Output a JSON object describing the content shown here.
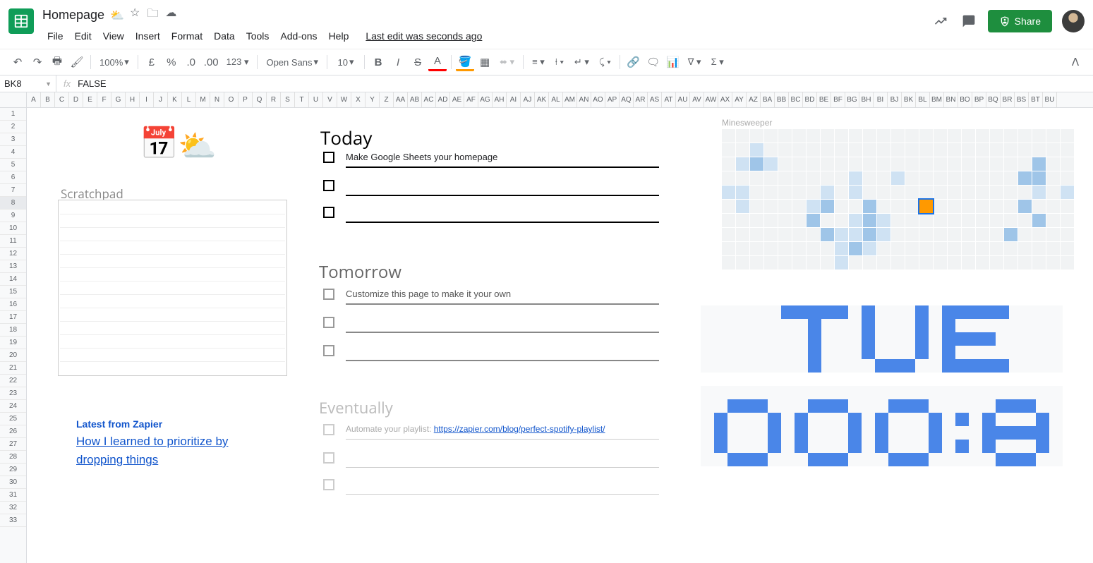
{
  "doc": {
    "title": "Homepage",
    "emoji": "⛅",
    "last_edit": "Last edit was seconds ago"
  },
  "menus": [
    "File",
    "Edit",
    "View",
    "Insert",
    "Format",
    "Data",
    "Tools",
    "Add-ons",
    "Help"
  ],
  "toolbar": {
    "zoom": "100%",
    "font": "Open Sans",
    "size": "10"
  },
  "share_label": "Share",
  "namebox": "BK8",
  "formula": "FALSE",
  "columns": [
    "A",
    "B",
    "C",
    "D",
    "E",
    "F",
    "G",
    "H",
    "I",
    "J",
    "K",
    "L",
    "M",
    "N",
    "O",
    "P",
    "Q",
    "R",
    "S",
    "T",
    "U",
    "V",
    "W",
    "X",
    "Y",
    "Z",
    "AA",
    "AB",
    "AC",
    "AD",
    "AE",
    "AF",
    "AG",
    "AH",
    "AI",
    "AJ",
    "AK",
    "AL",
    "AM",
    "AN",
    "AO",
    "AP",
    "AQ",
    "AR",
    "AS",
    "AT",
    "AU",
    "AV",
    "AW",
    "AX",
    "AY",
    "AZ",
    "BA",
    "BB",
    "BC",
    "BD",
    "BE",
    "BF",
    "BG",
    "BH",
    "BI",
    "BJ",
    "BK",
    "BL",
    "BM",
    "BN",
    "BO",
    "BP",
    "BQ",
    "BR",
    "BS",
    "BT",
    "BU"
  ],
  "rows": 33,
  "selected_row": 8,
  "scratchpad_label": "Scratchpad",
  "sections": {
    "today": {
      "title": "Today",
      "tasks": [
        "Make Google Sheets your homepage",
        "",
        ""
      ]
    },
    "tomorrow": {
      "title": "Tomorrow",
      "tasks": [
        "Customize this page to make it your own",
        "",
        ""
      ]
    },
    "eventually": {
      "title": "Eventually",
      "task_prefix": "Automate your playlist: ",
      "task_link": "https://zapier.com/blog/perfect-spotify-playlist/"
    }
  },
  "blog": {
    "heading": "Latest from Zapier",
    "title": "How I learned to prioritize by dropping things"
  },
  "minesweeper_label": "Minesweeper",
  "minesweeper": [
    ".........................",
    "..l......................",
    ".lml..................m..",
    ".........l..l........mm..",
    "ll.....l.l............l.l",
    ".l....lm..m..........m...",
    "......m..lml..........m..",
    ".......mllml........m....",
    "........lml..............",
    "........l................"
  ],
  "mine_selected": [
    5,
    14
  ],
  "day_glyph": [
    "......11111.1...1.11111....",
    "........1...1...1.1........",
    "........1...1...1.1111.....",
    "........1...1...1.1........",
    "........1....111..11111....",
    "...........................",
    "..111...111...111.....111..",
    ".1...1.1...1.1...1.1.1...1.",
    ".1...1.1...1.1...1...11111.",
    ".1...1.1...1.1...1.1.1...1.",
    "..111...111...111.....111.."
  ]
}
